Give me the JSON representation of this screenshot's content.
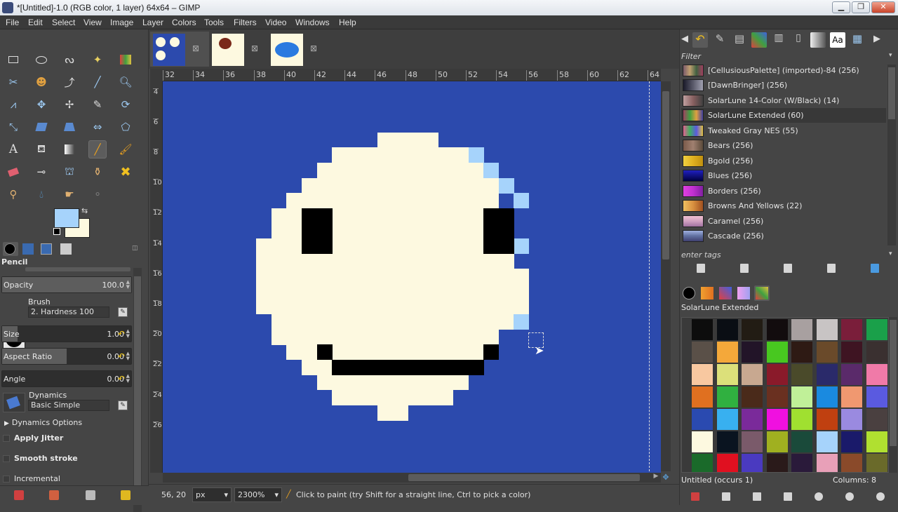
{
  "window": {
    "title": "*[Untitled]-1.0 (RGB color, 1 layer) 64x64 – GIMP"
  },
  "menu": [
    "File",
    "Edit",
    "Select",
    "View",
    "Image",
    "Layer",
    "Colors",
    "Tools",
    "Filters",
    "Video",
    "Windows",
    "Help"
  ],
  "tool_options": {
    "title": "Pencil",
    "opacity": {
      "label": "Opacity",
      "value": "100.0",
      "fraction": 1.0
    },
    "brush": {
      "label": "Brush",
      "value": "2. Hardness 100"
    },
    "size": {
      "label": "Size",
      "value": "1.00",
      "fraction": 0.01
    },
    "aspect_ratio": {
      "label": "Aspect Ratio",
      "value": "0.00",
      "fraction": 0.5
    },
    "angle": {
      "label": "Angle",
      "value": "0.00",
      "fraction": 0.5
    },
    "dynamics": {
      "label": "Dynamics",
      "value": "Basic Simple"
    },
    "dynamics_options": "Dynamics Options",
    "apply_jitter": "Apply Jitter",
    "smooth_stroke": "Smooth stroke",
    "incremental": "Incremental"
  },
  "colors": {
    "foreground": "#a6d3fb",
    "background": "#fdf9e0",
    "canvas_bg": "#2c4aad",
    "face": "#fdf9e0",
    "highlight": "#a6d3fb",
    "ink": "#000000"
  },
  "ruler_h": [
    "32",
    "34",
    "36",
    "38",
    "40",
    "42",
    "44",
    "46",
    "48",
    "50",
    "52",
    "54",
    "56",
    "58",
    "60",
    "62",
    "64"
  ],
  "ruler_v": [
    "4",
    "6",
    "8",
    "10",
    "12",
    "14",
    "16",
    "18",
    "20",
    "22",
    "24",
    "26"
  ],
  "status": {
    "coords": "56, 20",
    "unit": "px",
    "zoom": "2300%",
    "message": "Click to paint (try Shift for a straight line, Ctrl to pick a color)"
  },
  "palettes": {
    "filter_label": "Filter",
    "tags_placeholder": "enter tags",
    "items": [
      {
        "name": "[CellusiousPalette] (imported)-84 (256)",
        "color": "#7a5a6a"
      },
      {
        "name": "[DawnBringer] (256)",
        "color": "#5a5a6a"
      },
      {
        "name": "SolarLune 14-Color (W/Black) (14)",
        "color": "#886060"
      },
      {
        "name": "SolarLune Extended (60)",
        "color": "#a04060"
      },
      {
        "name": "Tweaked Gray NES (55)",
        "color": "#7a6a8a"
      },
      {
        "name": "Bears (256)",
        "color": "#7a5a4a"
      },
      {
        "name": "Bgold (256)",
        "color": "#e0b020"
      },
      {
        "name": "Blues (256)",
        "color": "#101080"
      },
      {
        "name": "Borders (256)",
        "color": "#c030d0"
      },
      {
        "name": "Browns And Yellows (22)",
        "color": "#d89040"
      },
      {
        "name": "Caramel (256)",
        "color": "#d0a0c0"
      },
      {
        "name": "Cascade (256)",
        "color": "#6070a0"
      }
    ]
  },
  "palette_editor": {
    "title": "SolarLune Extended",
    "status": "Untitled (occurs 1)",
    "columns": "Columns: 8",
    "swatches": [
      "#0d0d0d",
      "#0a0e14",
      "#221c14",
      "#120c0e",
      "#a8a0a0",
      "#c8c4c4",
      "#7a1e3a",
      "#1aa04a",
      "#5a5048",
      "#f4a83a",
      "#221428",
      "#48c820",
      "#2e1a14",
      "#6a4a2a",
      "#3e1422",
      "#3a3030",
      "#f8c8a0",
      "#dce07a",
      "#c8a890",
      "#8a1a2a",
      "#4a4a2a",
      "#2a2a6a",
      "#5a2a6a",
      "#f07aa8",
      "#e07020",
      "#30b040",
      "#4a2a1a",
      "#6a3020",
      "#c0f098",
      "#1a8ae0",
      "#f09870",
      "#5a5ae0",
      "#2a4ab0",
      "#38b0f0",
      "#7a2a9a",
      "#f010e0",
      "#a0e030",
      "#c04010",
      "#9a8ae0",
      "#4a4040",
      "#fdf9e0",
      "#0a1420",
      "#7a5a6a",
      "#a0b020",
      "#1a4a3a",
      "#a6d3fb",
      "#1a1a6a",
      "#b0e030",
      "#1a6a2a",
      "#e01020",
      "#4a3ac0",
      "#2a1a1a",
      "#2a1a3a",
      "#e8a0b8",
      "#8a4a2a",
      "#6a6a2a"
    ]
  }
}
